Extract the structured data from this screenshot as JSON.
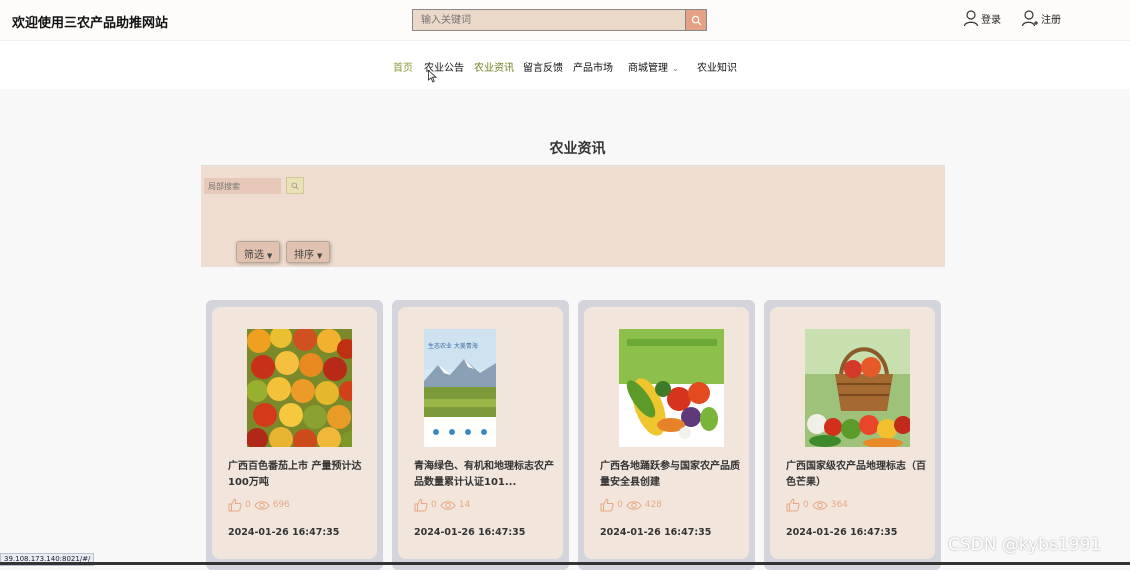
{
  "header": {
    "site_title": "欢迎使用三农产品助推网站",
    "search": {
      "placeholder": "输入关键词"
    },
    "login_label": "登录",
    "register_label": "注册"
  },
  "nav": {
    "items": [
      {
        "label": "首页"
      },
      {
        "label": "农业公告"
      },
      {
        "label": "农业资讯"
      },
      {
        "label": "留言反馈"
      },
      {
        "label": "产品市场"
      },
      {
        "label": "商城管理"
      },
      {
        "label": "农业知识"
      }
    ]
  },
  "main": {
    "page_title": "农业资讯",
    "local_search_placeholder": "局部搜索",
    "filter_label": "筛选",
    "sort_label": "排序"
  },
  "cards": [
    {
      "title": "广西百色番茄上市 产量预计达100万吨",
      "likes": "0",
      "views": "696",
      "date": "2024-01-26 16:47:35"
    },
    {
      "title": "青海绿色、有机和地理标志农产品数量累计认证101...",
      "likes": "0",
      "views": "14",
      "date": "2024-01-26 16:47:35",
      "image_caption": "生态农业 大美青海"
    },
    {
      "title": "广西各地踊跃参与国家农产品质量安全县创建",
      "likes": "0",
      "views": "428",
      "date": "2024-01-26 16:47:35"
    },
    {
      "title": "广西国家级农产品地理标志（百色芒果）",
      "likes": "0",
      "views": "364",
      "date": "2024-01-26 16:47:35"
    }
  ],
  "status_bar": {
    "url": "39.108.173.140:8021/#/"
  },
  "watermark": "CSDN @kybs1991",
  "colors": {
    "accent": "#e4a184",
    "panel": "#eeddd0",
    "card": "#f2e6dc",
    "nav_active": "#8a9b3a"
  }
}
